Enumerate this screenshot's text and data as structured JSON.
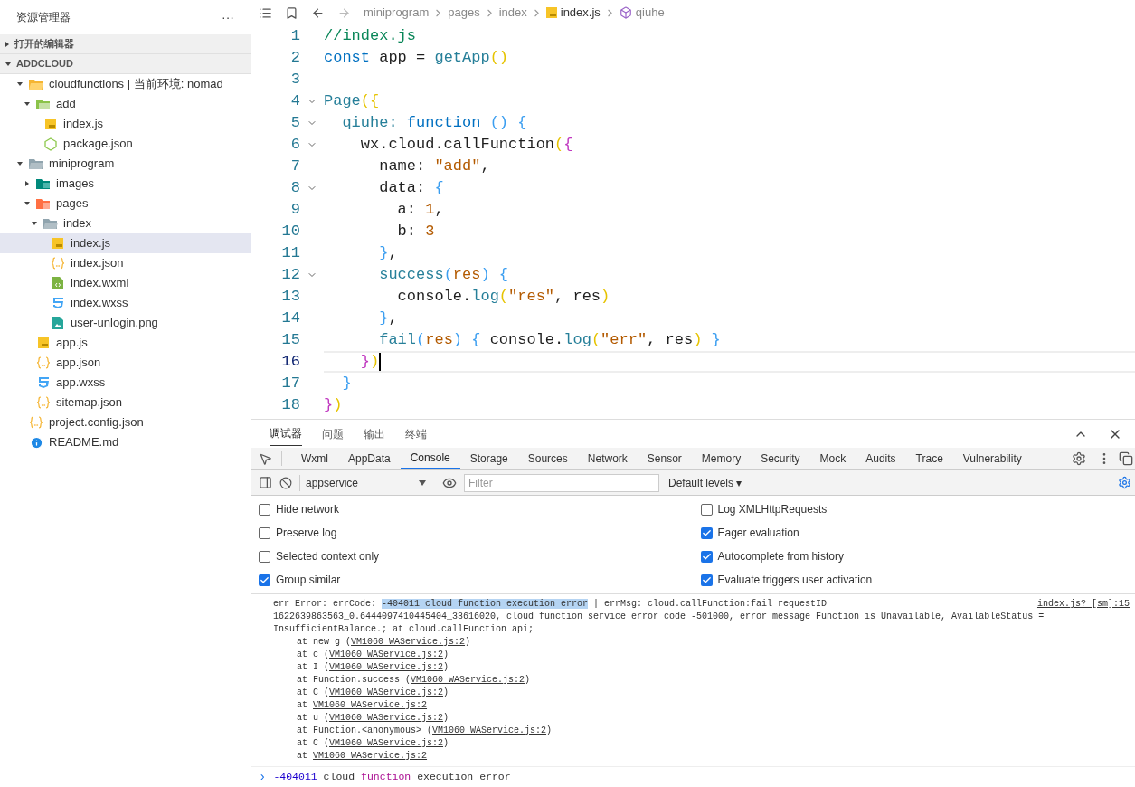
{
  "sidebar": {
    "title": "资源管理器",
    "more": "···",
    "sections": [
      {
        "label": "打开的编辑器",
        "expanded": false
      },
      {
        "label": "ADDCLOUD",
        "expanded": true
      }
    ],
    "tree": [
      {
        "label": "cloudfunctions | 当前环境: nomad",
        "kind": "folder-cloud",
        "expanded": true,
        "selected": false,
        "children": [
          {
            "label": "add",
            "kind": "folder-green",
            "expanded": true,
            "selected": false,
            "children": [
              {
                "label": "index.js",
                "kind": "js",
                "selected": false
              },
              {
                "label": "package.json",
                "kind": "node",
                "selected": false
              }
            ]
          }
        ]
      },
      {
        "label": "miniprogram",
        "kind": "folder-grey",
        "expanded": true,
        "selected": false,
        "children": [
          {
            "label": "images",
            "kind": "folder-images",
            "expanded": false,
            "selected": false
          },
          {
            "label": "pages",
            "kind": "folder-pages",
            "expanded": true,
            "selected": false,
            "children": [
              {
                "label": "index",
                "kind": "folder-grey",
                "expanded": true,
                "selected": false,
                "children": [
                  {
                    "label": "index.js",
                    "kind": "js",
                    "selected": true
                  },
                  {
                    "label": "index.json",
                    "kind": "json",
                    "selected": false
                  },
                  {
                    "label": "index.wxml",
                    "kind": "wxml",
                    "selected": false
                  },
                  {
                    "label": "index.wxss",
                    "kind": "wxss",
                    "selected": false
                  },
                  {
                    "label": "user-unlogin.png",
                    "kind": "image",
                    "selected": false
                  }
                ]
              }
            ]
          },
          {
            "label": "app.js",
            "kind": "js",
            "selected": false
          },
          {
            "label": "app.json",
            "kind": "json",
            "selected": false
          },
          {
            "label": "app.wxss",
            "kind": "wxss",
            "selected": false
          },
          {
            "label": "sitemap.json",
            "kind": "json",
            "selected": false
          }
        ]
      },
      {
        "label": "project.config.json",
        "kind": "json",
        "selected": false
      },
      {
        "label": "README.md",
        "kind": "info",
        "selected": false
      }
    ]
  },
  "breadcrumb": [
    "miniprogram",
    "pages",
    "index",
    "index.js",
    "qiuhe"
  ],
  "editor": {
    "lines": [
      {
        "number": "1",
        "fold": false,
        "current": false,
        "tokens": [
          {
            "text": "//index.js",
            "kind": "comment"
          }
        ]
      },
      {
        "number": "2",
        "fold": false,
        "current": false,
        "tokens": [
          {
            "text": "const",
            "kind": "keyword"
          },
          {
            "text": " app = ",
            "kind": "plain"
          },
          {
            "text": "getApp",
            "kind": "func"
          },
          {
            "text": "()",
            "kind": "paren"
          }
        ]
      },
      {
        "number": "3",
        "fold": false,
        "current": false
      },
      {
        "number": "4",
        "fold": true,
        "current": false,
        "tokens": [
          {
            "text": "Page",
            "kind": "func"
          },
          {
            "text": "({",
            "kind": "paren"
          }
        ]
      },
      {
        "number": "5",
        "fold": true,
        "current": false,
        "tokens": [
          {
            "text": "  qiuhe: ",
            "kind": "func"
          },
          {
            "text": "function",
            "kind": "keyword"
          },
          {
            "text": " () {",
            "kind": "brace"
          }
        ]
      },
      {
        "number": "6",
        "fold": true,
        "current": false,
        "tokens": [
          {
            "text": "    wx.cloud.callFunction",
            "kind": "plain"
          },
          {
            "text": "(",
            "kind": "paren"
          },
          {
            "text": "{",
            "kind": "brace2"
          }
        ]
      },
      {
        "number": "7",
        "fold": false,
        "current": false,
        "tokens": [
          {
            "text": "      name: ",
            "kind": "plain"
          },
          {
            "text": "\"add\"",
            "kind": "string"
          },
          {
            "text": ",",
            "kind": "plain"
          }
        ]
      },
      {
        "number": "8",
        "fold": true,
        "current": false,
        "tokens": [
          {
            "text": "      data: ",
            "kind": "plain"
          },
          {
            "text": "{",
            "kind": "brace"
          }
        ]
      },
      {
        "number": "9",
        "fold": false,
        "current": false,
        "tokens": [
          {
            "text": "        a: ",
            "kind": "plain"
          },
          {
            "text": "1",
            "kind": "number"
          },
          {
            "text": ",",
            "kind": "plain"
          }
        ]
      },
      {
        "number": "10",
        "fold": false,
        "current": false,
        "tokens": [
          {
            "text": "        b: ",
            "kind": "plain"
          },
          {
            "text": "3",
            "kind": "number"
          }
        ]
      },
      {
        "number": "11",
        "fold": false,
        "current": false,
        "tokens": [
          {
            "text": "      }",
            "kind": "brace"
          },
          {
            "text": ",",
            "kind": "plain"
          }
        ]
      },
      {
        "number": "12",
        "fold": true,
        "current": false,
        "tokens": [
          {
            "text": "      success",
            "kind": "func"
          },
          {
            "text": "(",
            "kind": "brace"
          },
          {
            "text": "res",
            "kind": "string"
          },
          {
            "text": ") {",
            "kind": "brace"
          }
        ]
      },
      {
        "number": "13",
        "fold": false,
        "current": false,
        "tokens": [
          {
            "text": "        console.",
            "kind": "plain"
          },
          {
            "text": "log",
            "kind": "func"
          },
          {
            "text": "(",
            "kind": "paren"
          },
          {
            "text": "\"res\"",
            "kind": "string"
          },
          {
            "text": ", res",
            "kind": "plain"
          },
          {
            "text": ")",
            "kind": "paren"
          }
        ]
      },
      {
        "number": "14",
        "fold": false,
        "current": false,
        "tokens": [
          {
            "text": "      }",
            "kind": "brace"
          },
          {
            "text": ",",
            "kind": "plain"
          }
        ]
      },
      {
        "number": "15",
        "fold": false,
        "current": false,
        "tokens": [
          {
            "text": "      fail",
            "kind": "func"
          },
          {
            "text": "(",
            "kind": "brace"
          },
          {
            "text": "res",
            "kind": "string"
          },
          {
            "text": ") { ",
            "kind": "brace"
          },
          {
            "text": "console.",
            "kind": "plain"
          },
          {
            "text": "log",
            "kind": "func"
          },
          {
            "text": "(",
            "kind": "paren"
          },
          {
            "text": "\"err\"",
            "kind": "string"
          },
          {
            "text": ", res",
            "kind": "plain"
          },
          {
            "text": ")",
            "kind": "paren"
          },
          {
            "text": " }",
            "kind": "brace"
          }
        ]
      },
      {
        "number": "16",
        "fold": false,
        "current": true,
        "tokens": [
          {
            "text": "    }",
            "kind": "brace2"
          },
          {
            "text": ")",
            "kind": "paren"
          }
        ]
      },
      {
        "number": "17",
        "fold": false,
        "current": false,
        "tokens": [
          {
            "text": "  }",
            "kind": "brace"
          }
        ]
      },
      {
        "number": "18",
        "fold": false,
        "current": false,
        "tokens": [
          {
            "text": "}",
            "kind": "brace2"
          },
          {
            "text": ")",
            "kind": "paren"
          }
        ]
      }
    ]
  },
  "panel_tabs": [
    {
      "label": "调试器",
      "selected": true
    },
    {
      "label": "问题",
      "selected": false
    },
    {
      "label": "输出",
      "selected": false
    },
    {
      "label": "终端",
      "selected": false
    }
  ],
  "devtools_tabs": [
    {
      "label": "Wxml",
      "selected": false
    },
    {
      "label": "AppData",
      "selected": false
    },
    {
      "label": "Console",
      "selected": true
    },
    {
      "label": "Storage",
      "selected": false
    },
    {
      "label": "Sources",
      "selected": false
    },
    {
      "label": "Network",
      "selected": false
    },
    {
      "label": "Sensor",
      "selected": false
    },
    {
      "label": "Memory",
      "selected": false
    },
    {
      "label": "Security",
      "selected": false
    },
    {
      "label": "Mock",
      "selected": false
    },
    {
      "label": "Audits",
      "selected": false
    },
    {
      "label": "Trace",
      "selected": false
    },
    {
      "label": "Vulnerability",
      "selected": false
    }
  ],
  "toolbar": {
    "context": "appservice",
    "filter_placeholder": "Filter",
    "levels": "Default levels ▾"
  },
  "settings_left": [
    {
      "label": "Hide network",
      "checked": false
    },
    {
      "label": "Preserve log",
      "checked": false
    },
    {
      "label": "Selected context only",
      "checked": false
    },
    {
      "label": "Group similar",
      "checked": true
    }
  ],
  "settings_right": [
    {
      "label": "Log XMLHttpRequests",
      "checked": false
    },
    {
      "label": "Eager evaluation",
      "checked": true
    },
    {
      "label": "Autocomplete from history",
      "checked": true
    },
    {
      "label": "Evaluate triggers user activation",
      "checked": true
    }
  ],
  "console_output": {
    "message": {
      "lines": [
        {
          "parts": [
            {
              "text": "err Error: errCode: ",
              "kind": "plain"
            },
            {
              "text": "-404011 cloud function execution error",
              "kind": "highlight"
            },
            {
              "text": " | errMsg: cloud.callFunction:fail requestID",
              "kind": "plain"
            }
          ]
        },
        {
          "parts": [
            {
              "text": "1622639863563_0.6444097410445404_33616020, cloud function service error code -501000, error message Function is Unavailable, AvailableStatus =",
              "kind": "plain"
            }
          ]
        },
        {
          "parts": [
            {
              "text": "InsufficientBalance.; at cloud.callFunction api;",
              "kind": "plain"
            }
          ]
        }
      ],
      "source": "index.js? [sm]:15",
      "stack": [
        {
          "prefix": "at new g (",
          "link": "VM1060 WAService.js:2",
          "suffix": ")"
        },
        {
          "prefix": "at c (",
          "link": "VM1060 WAService.js:2",
          "suffix": ")"
        },
        {
          "prefix": "at I (",
          "link": "VM1060 WAService.js:2",
          "suffix": ")"
        },
        {
          "prefix": "at Function.success (",
          "link": "VM1060 WAService.js:2",
          "suffix": ")"
        },
        {
          "prefix": "at C (",
          "link": "VM1060 WAService.js:2",
          "suffix": ")"
        },
        {
          "prefix": "at ",
          "link": "VM1060 WAService.js:2"
        },
        {
          "prefix": "at u (",
          "link": "VM1060 WAService.js:2",
          "suffix": ")"
        },
        {
          "prefix": "at Function.<anonymous> (",
          "link": "VM1060 WAService.js:2",
          "suffix": ")"
        },
        {
          "prefix": "at C (",
          "link": "VM1060 WAService.js:2",
          "suffix": ")"
        },
        {
          "prefix": "at ",
          "link": "VM1060 WAService.js:2"
        }
      ]
    },
    "prompt": {
      "chevron": "›",
      "tokens": [
        {
          "text": "-404011",
          "kind": "number"
        },
        {
          "text": " cloud ",
          "kind": "plain"
        },
        {
          "text": "function",
          "kind": "keyword"
        },
        {
          "text": " execution error",
          "kind": "plain"
        }
      ]
    }
  }
}
